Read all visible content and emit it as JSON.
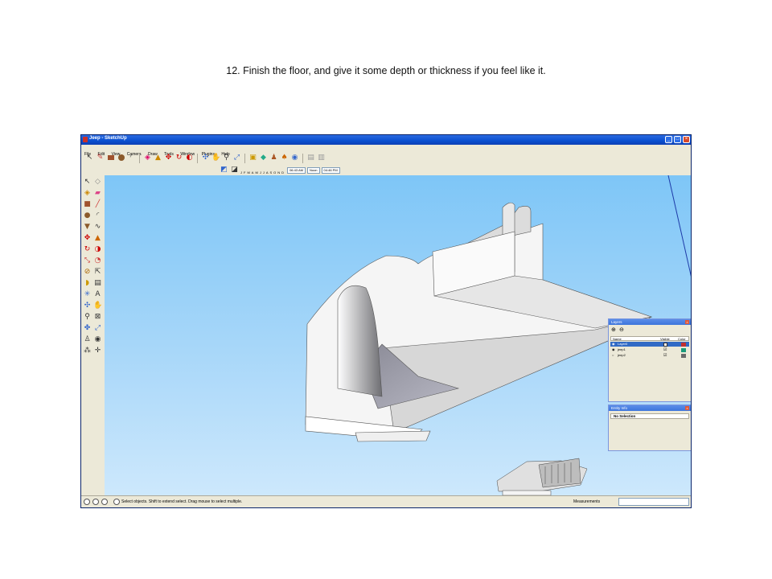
{
  "caption": "12. Finish the floor, and give it some depth or thickness if you feel like it.",
  "window": {
    "title": "Jeep - SketchUp",
    "controls": [
      "_",
      "□",
      "×"
    ]
  },
  "menu": [
    "File",
    "Edit",
    "View",
    "Camera",
    "Draw",
    "Tools",
    "Window",
    "Plugins",
    "Help"
  ],
  "toolbar": {
    "icons": [
      "select-icon",
      "eraser-icon",
      "rectangle-icon",
      "circle-icon",
      "arc-icon",
      "paint-icon",
      "push-pull-icon",
      "move-icon",
      "rotate-icon",
      "orbit-icon",
      "pan-icon",
      "zoom-icon",
      "zoom-extents-icon",
      "components-icon",
      "materials-icon",
      "get-models-icon",
      "share-model-icon",
      "place-model-icon",
      "google-earth-icon"
    ],
    "shadow_months": [
      "J",
      "F",
      "M",
      "A",
      "M",
      "J",
      "J",
      "A",
      "S",
      "O",
      "N",
      "D"
    ],
    "time_start": "06:43 AM",
    "time_noon": "Noon",
    "time_end": "04:46 PM"
  },
  "layers_panel": {
    "title": "Layers",
    "columns": {
      "name": "Name",
      "visible": "Visible",
      "color": "Color"
    },
    "rows": [
      {
        "name": "Layer0",
        "selected": true,
        "visible": true,
        "color": "#c03030"
      },
      {
        "name": "jeep1",
        "selected": false,
        "visible": true,
        "color": "#1a9a7a"
      },
      {
        "name": "jeep2",
        "selected": false,
        "visible": true,
        "color": "#6a6a6a"
      }
    ]
  },
  "entity_panel": {
    "title": "Entity Info",
    "selection": "No Selection"
  },
  "status": {
    "hint": "Select objects. Shift to extend select. Drag mouse to select multiple.",
    "measurements_label": "Measurements"
  },
  "colors": {
    "sky_top": "#7ec6f7",
    "sky_bottom": "#cde8fc",
    "titlebar": "#0a4fd0"
  }
}
